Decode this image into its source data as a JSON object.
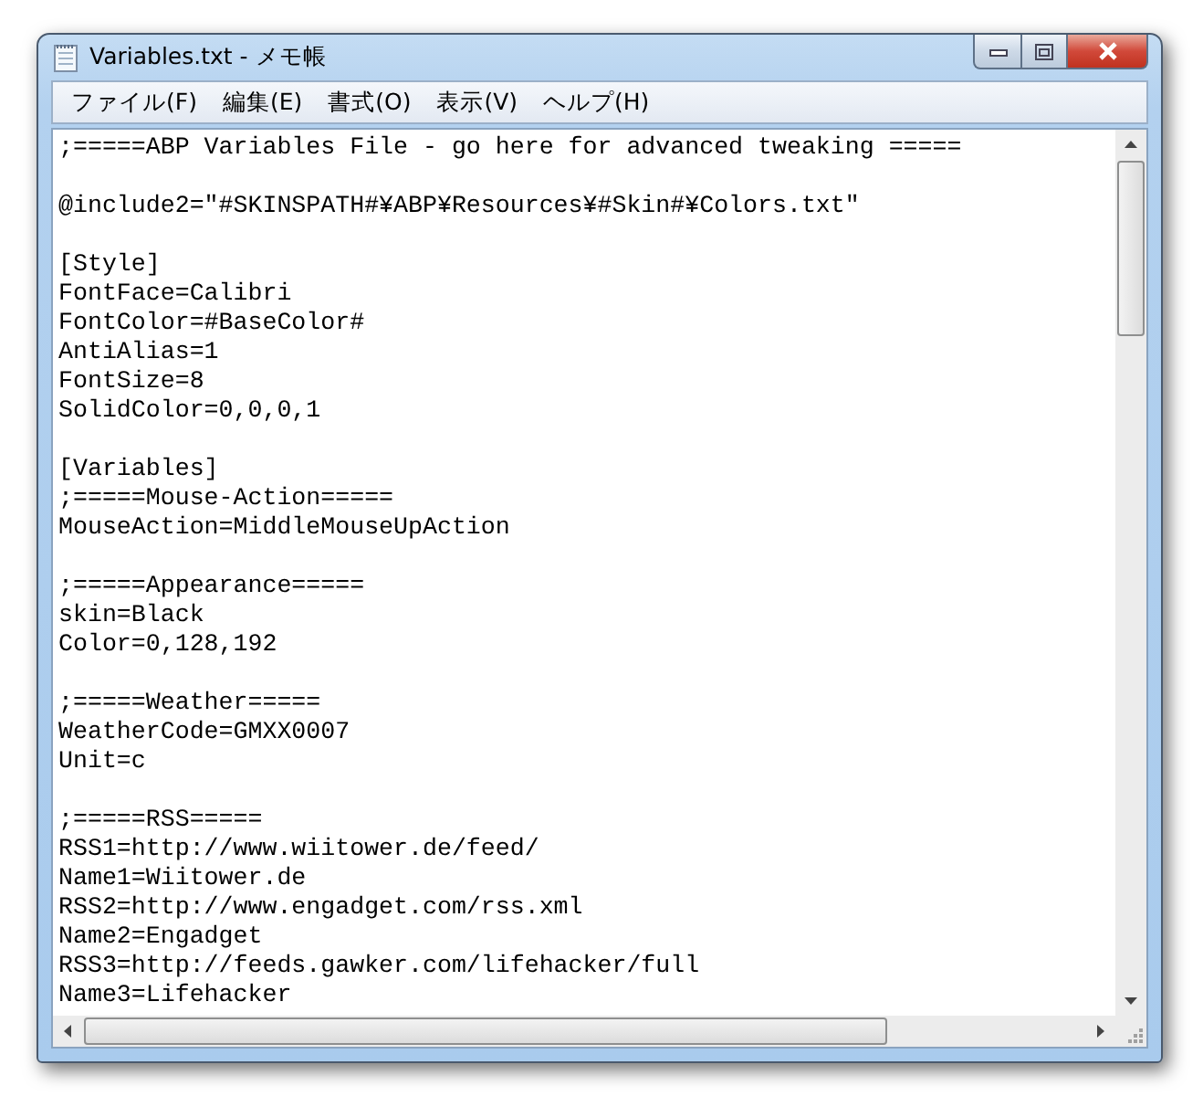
{
  "window": {
    "title": "Variables.txt - メモ帳"
  },
  "menu": [
    "ファイル(F)",
    "編集(E)",
    "書式(O)",
    "表示(V)",
    "ヘルプ(H)"
  ],
  "document": {
    "paragraphs": [
      [
        ";=====ABP Variables File - go here for advanced tweaking ====="
      ],
      [
        "@include2=\"#SKINSPATH#¥ABP¥Resources¥#Skin#¥Colors.txt\""
      ],
      [
        "[Style]",
        "FontFace=Calibri",
        "FontColor=#BaseColor#",
        "AntiAlias=1",
        "FontSize=8",
        "SolidColor=0,0,0,1"
      ],
      [
        "[Variables]",
        ";=====Mouse-Action=====",
        "MouseAction=MiddleMouseUpAction"
      ],
      [
        ";=====Appearance=====",
        "skin=Black",
        "Color=0,128,192"
      ],
      [
        ";=====Weather=====",
        "WeatherCode=GMXX0007",
        "Unit=c"
      ],
      [
        ";=====RSS=====",
        "RSS1=http://www.wiitower.de/feed/",
        "Name1=Wiitower.de",
        "RSS2=http://www.engadget.com/rss.xml",
        "Name2=Engadget",
        "RSS3=http://feeds.gawker.com/lifehacker/full",
        "Name3=Lifehacker"
      ]
    ]
  }
}
